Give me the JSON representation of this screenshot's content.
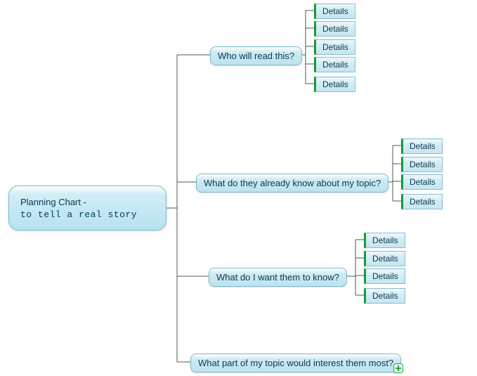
{
  "root": {
    "title": "Planning Chart -",
    "subtitle": "to tell a real story"
  },
  "branches": [
    {
      "label": "Who will read this?",
      "details": [
        "Details",
        "Details",
        "Details",
        "Details",
        "Details"
      ]
    },
    {
      "label": "What do they already know about my topic?",
      "details": [
        "Details",
        "Details",
        "Details",
        "Details"
      ]
    },
    {
      "label": "What do I want them to know?",
      "details": [
        "Details",
        "Details",
        "Details",
        "Details"
      ]
    },
    {
      "label": "What part of my topic would interest them most?",
      "details": []
    }
  ],
  "detail_label": "Details",
  "colors": {
    "node_border": "#7cb9cc",
    "node_fill_top": "#ffffff",
    "node_fill_bottom": "#bde2f1",
    "leaf_accent": "#169b3a",
    "connector": "#444444"
  }
}
